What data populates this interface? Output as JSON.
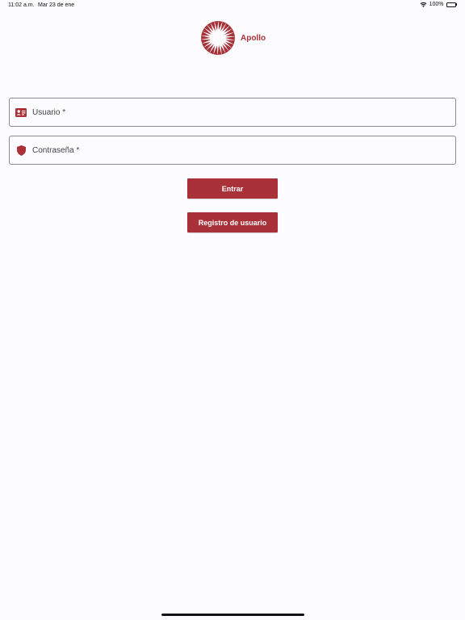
{
  "status_bar": {
    "time": "11:02 a.m.",
    "date": "Mar 23 de ene",
    "battery": "100%"
  },
  "brand": {
    "name": "Apollo",
    "color": "#a83239"
  },
  "form": {
    "username_placeholder": "Usuario *",
    "password_placeholder": "Contraseña *",
    "login_label": "Entrar",
    "register_label": "Registro de usuario"
  },
  "icons": {
    "username": "id-card-icon",
    "password": "shield-icon"
  },
  "colors": {
    "accent": "#a93239",
    "background": "#fcfbfd",
    "field_border": "#8a8a8f"
  }
}
